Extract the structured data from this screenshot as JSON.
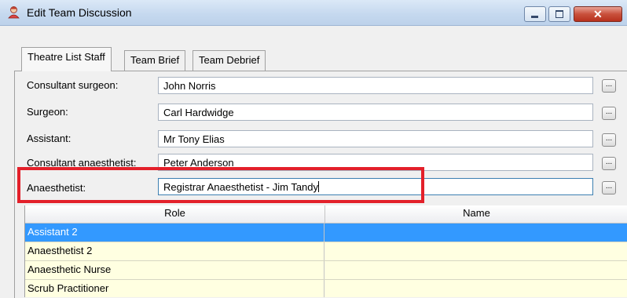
{
  "window": {
    "title": "Edit Team Discussion",
    "close_glyph": "✕"
  },
  "tabs": [
    {
      "label": "Theatre List Staff"
    },
    {
      "label": "Team Brief"
    },
    {
      "label": "Team Debrief"
    }
  ],
  "form": {
    "rows": [
      {
        "label": "Consultant surgeon:",
        "value": "John Norris"
      },
      {
        "label": "Surgeon:",
        "value": "Carl Hardwidge"
      },
      {
        "label": "Assistant:",
        "value": "Mr Tony Elias"
      },
      {
        "label": "Consultant anaesthetist:",
        "value": "Peter Anderson"
      },
      {
        "label": "Anaesthetist:",
        "value": "Registrar  Anaesthetist - Jim Tandy"
      }
    ],
    "browse_label": "..."
  },
  "grid": {
    "columns": [
      "Role",
      "Name"
    ],
    "rows": [
      {
        "role": "Assistant 2",
        "name": ""
      },
      {
        "role": "Anaesthetist 2",
        "name": ""
      },
      {
        "role": "Anaesthetic Nurse",
        "name": ""
      },
      {
        "role": "Scrub Practitioner",
        "name": ""
      }
    ]
  },
  "colors": {
    "highlight": "#e3202a",
    "selection": "#3399ff",
    "row_background": "#ffffe1"
  }
}
